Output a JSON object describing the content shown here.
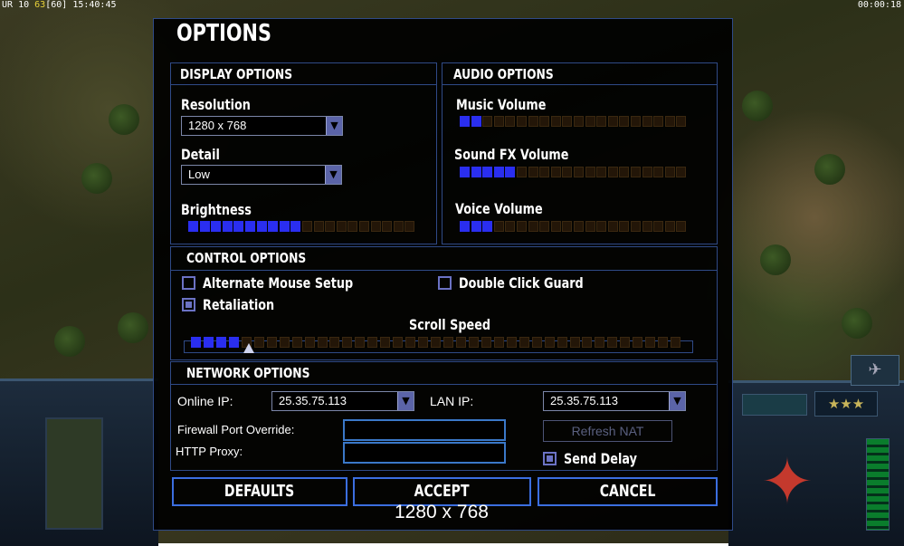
{
  "top_stats": {
    "prefix": "UR",
    "level": "10",
    "money": "63",
    "bracket": "[60]",
    "clock": "15:40:45"
  },
  "top_timer": "00:00:18",
  "dialog": {
    "title": "OPTIONS",
    "display": {
      "title": "DISPLAY OPTIONS",
      "resolution_label": "Resolution",
      "resolution_value": "1280 x 768",
      "detail_label": "Detail",
      "detail_value": "Low",
      "brightness_label": "Brightness",
      "brightness_level": 10,
      "brightness_total": 20
    },
    "audio": {
      "title": "AUDIO OPTIONS",
      "music_label": "Music Volume",
      "music_level": 2,
      "music_total": 20,
      "sfx_label": "Sound FX Volume",
      "sfx_level": 5,
      "sfx_total": 20,
      "voice_label": "Voice Volume",
      "voice_level": 3,
      "voice_total": 20
    },
    "control": {
      "title": "CONTROL OPTIONS",
      "alt_mouse_label": "Alternate Mouse Setup",
      "alt_mouse_checked": false,
      "double_click_label": "Double Click Guard",
      "double_click_checked": false,
      "retaliation_label": "Retaliation",
      "retaliation_checked": true,
      "scroll_label": "Scroll Speed",
      "scroll_level": 4,
      "scroll_total": 39
    },
    "network": {
      "title": "NETWORK OPTIONS",
      "online_ip_label": "Online IP:",
      "online_ip_value": "25.35.75.113",
      "lan_ip_label": "LAN IP:",
      "lan_ip_value": "25.35.75.113",
      "firewall_label": "Firewall Port Override:",
      "firewall_value": "",
      "http_proxy_label": "HTTP Proxy:",
      "http_proxy_value": "",
      "refresh_nat_label": "Refresh NAT",
      "send_delay_label": "Send Delay",
      "send_delay_checked": true
    },
    "buttons": {
      "defaults": "DEFAULTS",
      "accept": "ACCEPT",
      "cancel": "CANCEL"
    }
  },
  "overlay_text": "1280 x 768",
  "hud": {
    "rank_stars": "★★★"
  },
  "colors": {
    "accent": "#2f4a87",
    "slider_on": "#2a2ef0",
    "slider_off": "#231608",
    "button_border": "#3b6ee0"
  }
}
